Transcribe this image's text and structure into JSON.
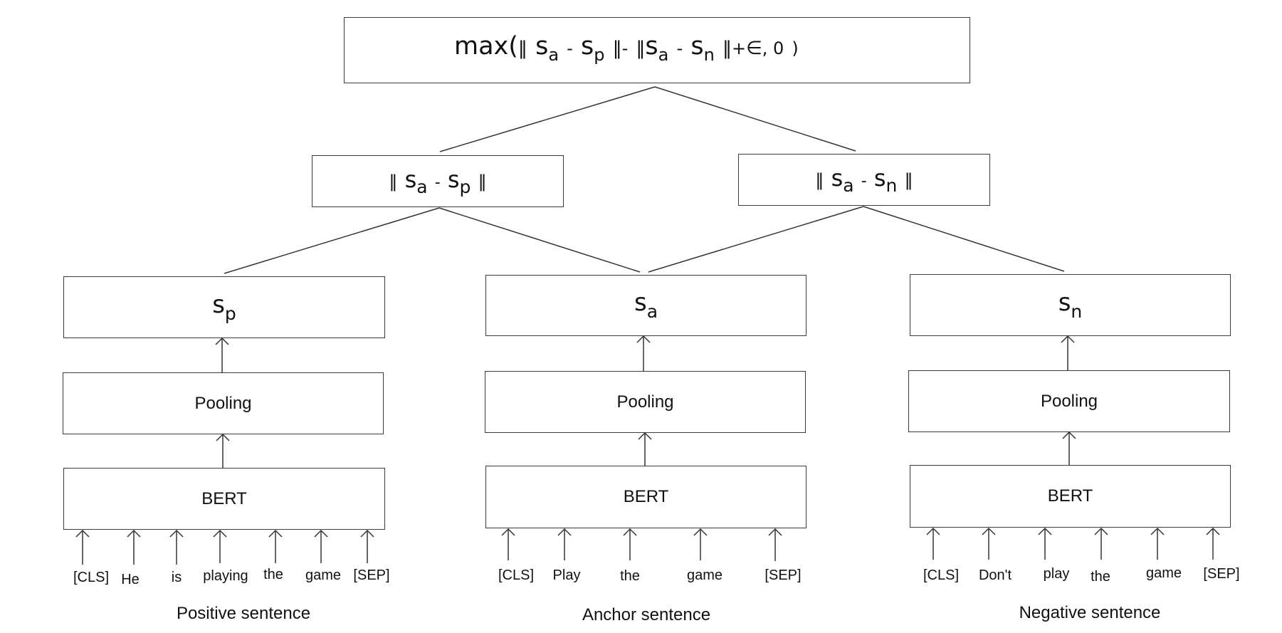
{
  "loss": {
    "prefix": "max(",
    "norm_open": "‖",
    "s": "s",
    "a": "a",
    "minus": "-",
    "p": "p",
    "n": "n",
    "norm_close": "‖",
    "plus": "+",
    "epsilon": "∈",
    "comma_zero": ", 0",
    "close": ")"
  },
  "distances": {
    "positive": {
      "lhs_sub": "a",
      "rhs_sub": "p"
    },
    "negative": {
      "lhs_sub": "a",
      "rhs_sub": "n"
    }
  },
  "columns": [
    {
      "id": "positive",
      "embedding": {
        "symbol": "s",
        "sub": "p"
      },
      "pooling_label": "Pooling",
      "encoder_label": "BERT",
      "tokens": [
        "[CLS]",
        "He",
        "is",
        "playing",
        "the",
        "game",
        "[SEP]"
      ],
      "caption": "Positive sentence"
    },
    {
      "id": "anchor",
      "embedding": {
        "symbol": "s",
        "sub": "a"
      },
      "pooling_label": "Pooling",
      "encoder_label": "BERT",
      "tokens": [
        "[CLS]",
        "Play",
        "the",
        "game",
        "[SEP]"
      ],
      "caption": "Anchor sentence"
    },
    {
      "id": "negative",
      "embedding": {
        "symbol": "s",
        "sub": "n"
      },
      "pooling_label": "Pooling",
      "encoder_label": "BERT",
      "tokens": [
        "[CLS]",
        "Don't",
        "play",
        "the",
        "game",
        "[SEP]"
      ],
      "caption": "Negative sentence"
    }
  ]
}
